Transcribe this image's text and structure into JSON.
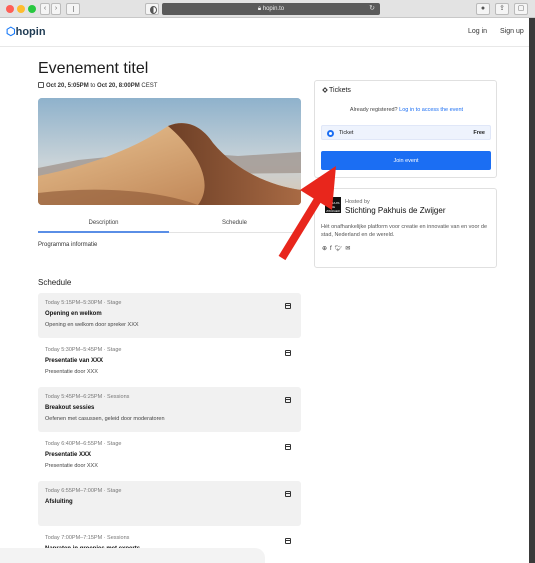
{
  "browser": {
    "url": "hopin.to"
  },
  "header": {
    "logo_text": "hopin",
    "login_label": "Log in",
    "signup_label": "Sign up"
  },
  "event": {
    "title": "Evenement titel",
    "date_start": "Oct 20, 5:05PM",
    "date_to": "to",
    "date_end": "Oct 20, 8:00PM",
    "timezone": "CEST"
  },
  "tabs": [
    {
      "label": "Description"
    },
    {
      "label": "Schedule"
    }
  ],
  "description": {
    "text": "Programma informatie"
  },
  "schedule": {
    "heading": "Schedule",
    "items": [
      {
        "time": "Today 5:15PM–5:30PM · Stage",
        "title": "Opening en welkom",
        "desc": "Opening en welkom door spreker XXX"
      },
      {
        "time": "Today 5:30PM–5:45PM · Stage",
        "title": "Presentatie van XXX",
        "desc": "Presentatie door XXX"
      },
      {
        "time": "Today 5:45PM–6:25PM · Sessions",
        "title": "Breakout sessies",
        "desc": "Oefenen met casussen, geleid door moderatoren"
      },
      {
        "time": "Today 6:40PM–6:55PM · Stage",
        "title": "Presentatie XXX",
        "desc": "Presentatie door XXX"
      },
      {
        "time": "Today 6:55PM–7:00PM · Stage",
        "title": "Afsluiting",
        "desc": ""
      },
      {
        "time": "Today 7:00PM–7:15PM · Sessions",
        "title": "Napraten in groepjes met experts",
        "desc": ""
      }
    ]
  },
  "tickets": {
    "title": "Tickets",
    "registered_text": "Already registered?",
    "registered_link": "Log in to access the event",
    "ticket_name": "Ticket",
    "ticket_price": "Free",
    "join_label": "Join event"
  },
  "host": {
    "hosted_by": "Hosted by",
    "name": "Stichting Pakhuis de Zwijger",
    "logo_text": "PAKHUIS DE ZWIJGER",
    "description": "Hét onafhankelijke platform voor creatie en innovatie van en voor de stad, Nederland en de wereld."
  },
  "colors": {
    "accent": "#1b6ef3",
    "arrow": "#e8261c"
  }
}
